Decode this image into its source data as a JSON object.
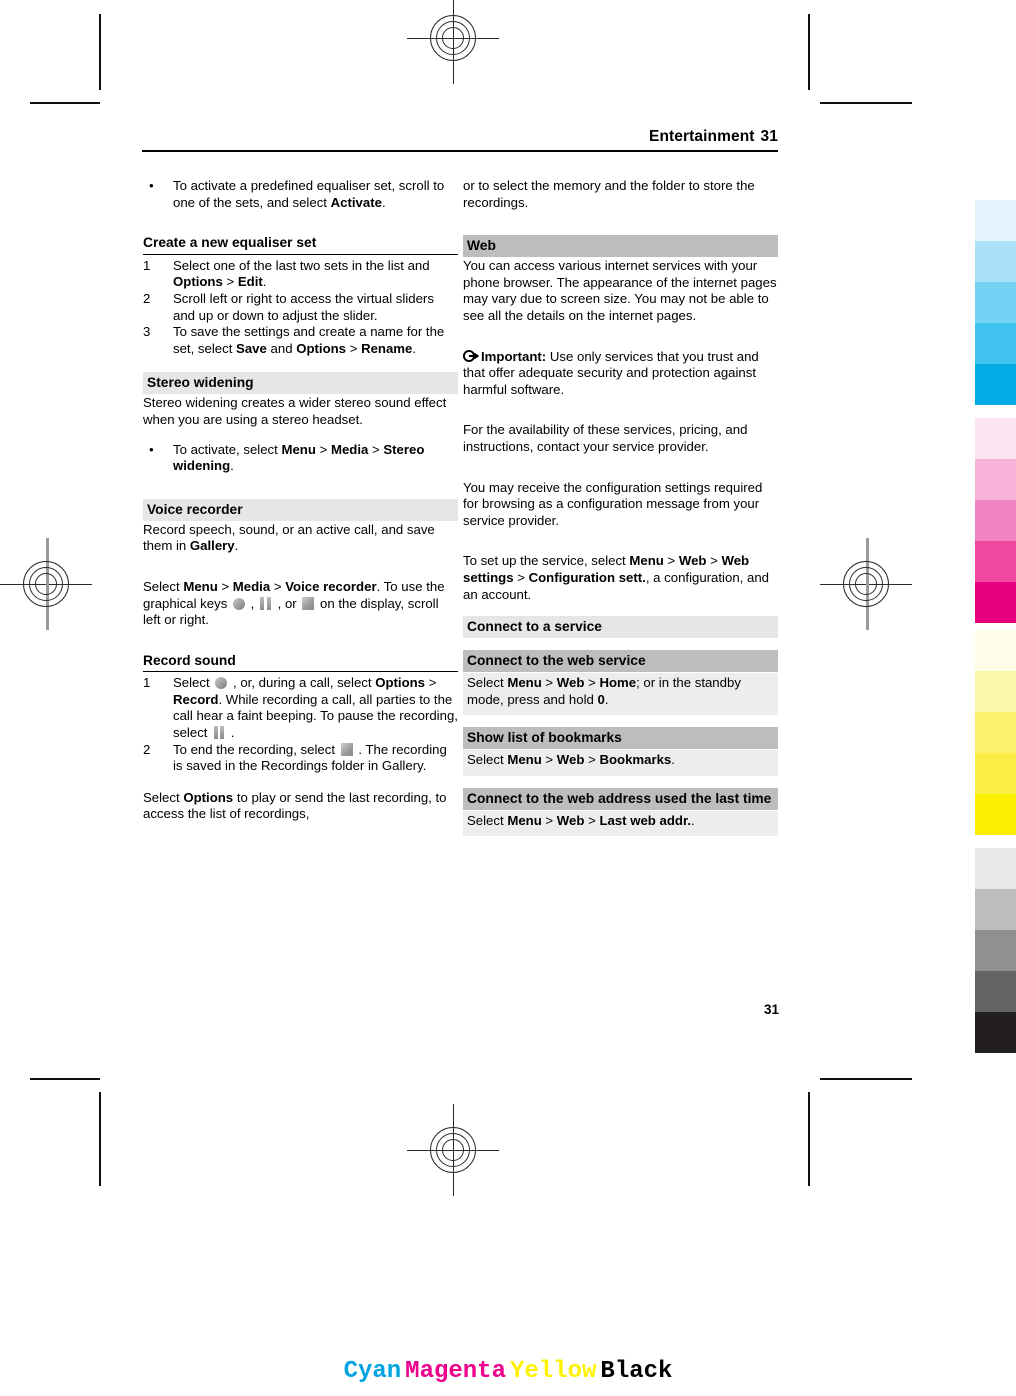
{
  "header": {
    "chapter": "Entertainment",
    "page_number": "31"
  },
  "footer": {
    "page_number": "31"
  },
  "left_column": {
    "bullet_activate": {
      "dot": "•",
      "text_part1": "To activate a predefined equaliser set, scroll to one of the sets, and select ",
      "bold1": "Activate",
      "text_part2": "."
    },
    "create_set": {
      "heading": "Create a new equaliser set",
      "steps": [
        {
          "num": "1",
          "t1": "Select one of the last two sets in the list and ",
          "b1": "Options",
          "t2": " > ",
          "b2": "Edit",
          "t3": "."
        },
        {
          "num": "2",
          "t1": "Scroll left or right to access the virtual sliders and up or down to adjust the slider.",
          "b1": "",
          "t2": "",
          "b2": "",
          "t3": ""
        },
        {
          "num": "3",
          "t1": "To save the settings and create a name for the set, select ",
          "b1": "Save",
          "t2": " and ",
          "b2": "Options",
          "t3": " > ",
          "b3": "Rename",
          "t4": "."
        }
      ]
    },
    "stereo_widening": {
      "heading": "Stereo widening",
      "body": "Stereo widening creates a wider stereo sound effect when you are using a stereo headset.",
      "bullet": {
        "dot": "•",
        "t1": "To activate, select ",
        "b1": "Menu",
        "t2": " > ",
        "b2": "Media",
        "t3": " > ",
        "b3": "Stereo widening",
        "t4": "."
      }
    },
    "voice_recorder": {
      "heading": "Voice recorder",
      "body_t1": "Record speech, sound, or an active call, and save them in ",
      "body_b1": "Gallery",
      "body_t2": ".",
      "select_t1": "Select ",
      "select_b1": "Menu",
      "select_t2": " > ",
      "select_b2": "Media",
      "select_t3": " > ",
      "select_b3": "Voice recorder",
      "select_t4": ". To use the graphical keys ",
      "select_t5": " , ",
      "select_t6": " , or ",
      "select_t7": " on the display, scroll left or right."
    },
    "record_sound": {
      "heading": "Record sound",
      "step1": {
        "num": "1",
        "t1": "Select ",
        "t2": " , or, during a call, select ",
        "b1": "Options",
        "t3": " > ",
        "b2": "Record",
        "t4": ". While recording a call, all parties to the call hear a faint beeping. To pause the recording, select ",
        "t5": " ."
      },
      "step2": {
        "num": "2",
        "t1": "To end the recording, select ",
        "t2": " . The recording is saved in the Recordings folder in Gallery."
      },
      "closing_t1": "Select ",
      "closing_b1": "Options",
      "closing_t2": " to play or send the last recording, to access the list of recordings,"
    }
  },
  "right_column": {
    "continuation": "or to select the memory and the folder to store the recordings.",
    "web": {
      "heading": "Web",
      "intro": "You can access various internet services with your phone browser. The appearance of the internet pages may vary due to screen size. You may not be able to see all the details on the internet pages.",
      "important_label": "Important:",
      "important_body": " Use only services that you trust and that offer adequate security and protection against harmful software.",
      "availability": "For the availability of these services, pricing, and instructions, contact your service provider.",
      "config_msg": "You may receive the configuration settings required for browsing as a configuration message from your service provider.",
      "setup_t1": "To set up the service, select ",
      "setup_b1": "Menu",
      "setup_t2": " > ",
      "setup_b2": "Web",
      "setup_t3": " > ",
      "setup_b3": "Web settings",
      "setup_t4": " > ",
      "setup_b4": "Configuration sett.",
      "setup_t5": ", a configuration, and an account."
    },
    "connect_service": {
      "heading": "Connect to a service"
    },
    "connect_web_service": {
      "heading": "Connect to the web service",
      "t1": "Select ",
      "b1": "Menu",
      "t2": " > ",
      "b2": "Web",
      "t3": " > ",
      "b3": "Home",
      "t4": "; or in the standby mode, press and hold ",
      "b4": "0",
      "t5": "."
    },
    "show_bookmarks": {
      "heading": "Show list of bookmarks",
      "t1": "Select ",
      "b1": "Menu",
      "t2": " > ",
      "b2": "Web",
      "t3": " > ",
      "b3": "Bookmarks",
      "t4": "."
    },
    "last_web_address": {
      "heading": "Connect to the web address used the last time",
      "t1": "Select ",
      "b1": "Menu",
      "t2": " > ",
      "b2": "Web",
      "t3": " > ",
      "b3": "Last web addr.",
      "t4": "."
    }
  },
  "print_marks": {
    "cmyk_labels": [
      {
        "name": "Cyan",
        "color": "#00a3e0"
      },
      {
        "name": "Magenta",
        "color": "#ec008c"
      },
      {
        "name": "Yellow",
        "color": "#fff200"
      },
      {
        "name": "Black",
        "color": "#000000"
      }
    ],
    "swatches": {
      "cyan": [
        "#e4f4fd",
        "#a9e2f8",
        "#73d3f4",
        "#40c4ef",
        "#00ace3"
      ],
      "magenta": [
        "#fbe3ef",
        "#f6b2d7",
        "#f083c1",
        "#f0489f",
        "#e6007e"
      ],
      "yellow": [
        "#fffde8",
        "#fdf7ab",
        "#fdf16f",
        "#fdee45",
        "#fbee00"
      ],
      "black": [
        "#e8e8e8",
        "#bdbdbd",
        "#909090",
        "#636363",
        "#231f20"
      ]
    }
  }
}
